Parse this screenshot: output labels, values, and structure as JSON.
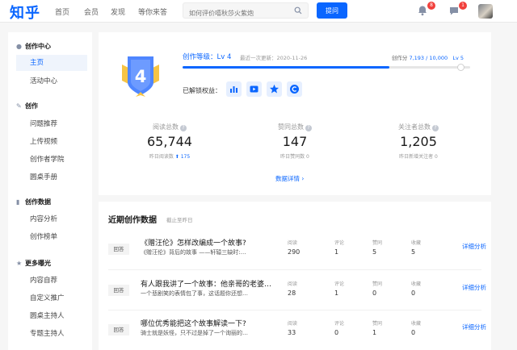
{
  "header": {
    "logo": "知乎",
    "nav": [
      "首页",
      "会员",
      "发现",
      "等你来答"
    ],
    "search_placeholder": "如何评价嘻秋莎火紫炮",
    "ask_label": "提问",
    "notification_count": "8",
    "message_count": "1"
  },
  "sidebar": {
    "sections": [
      {
        "title": "创作中心",
        "icon": "person-icon",
        "items": [
          "主页",
          "活动中心"
        ]
      },
      {
        "title": "创作",
        "icon": "pen-icon",
        "items": [
          "问题推荐",
          "上传视频",
          "创作者学院",
          "圆桌手册"
        ]
      },
      {
        "title": "创作数据",
        "icon": "chart-icon",
        "items": [
          "内容分析",
          "创作榜单"
        ]
      },
      {
        "title": "更多曝光",
        "icon": "star-icon",
        "items": [
          "内容自荐",
          "自定义推广",
          "圆桌主持人",
          "专题主持人"
        ]
      }
    ],
    "active_item": "主页"
  },
  "level": {
    "badge_number": "4",
    "title": "创作等级：Lv 4",
    "updated": "最近一次更新：2020-11-26",
    "score_label": "创作分",
    "score_value": "7,193 / 10,000",
    "next_level": "Lv 5",
    "progress_fraction": 0.7193,
    "rights_label": "已解锁权益：",
    "rights_icons": [
      "bar-chart-icon",
      "video-icon",
      "star-icon",
      "c-coin-icon"
    ]
  },
  "stats": [
    {
      "label": "阅读总数",
      "value": "65,744",
      "sub_prefix": "昨日阅读数",
      "sub_value": "175"
    },
    {
      "label": "赞同总数",
      "value": "147",
      "sub_prefix": "昨日赞同数",
      "sub_value": "0"
    },
    {
      "label": "关注者总数",
      "value": "1,205",
      "sub_prefix": "昨日新增关注者",
      "sub_value": "0"
    }
  ],
  "detail_link": "数据详情 ›",
  "recent": {
    "title": "近期创作数据",
    "subtitle": "截止至昨日",
    "metric_labels": [
      "阅读",
      "评论",
      "赞同",
      "收藏"
    ],
    "link_label": "详细分析",
    "rows": [
      {
        "tag": "回答",
        "title": "《赠汪伦》怎样改编成一个故事?",
        "excerpt": "《赠汪伦》背后的故事 ——轩辕三缺时:…",
        "metrics": [
          "290",
          "1",
          "5",
          "5"
        ]
      },
      {
        "tag": "回答",
        "title": "有人跟我讲了一个故事：他亲哥的老婆…",
        "excerpt": "一个悲剧笑的表情包了事，这话题你还想…",
        "metrics": [
          "28",
          "1",
          "0",
          "0"
        ]
      },
      {
        "tag": "回答",
        "title": "哪位优秀能把这个故事解读一下?",
        "excerpt": "骑士就是妖怪，只不过是掉了一个询丽的…",
        "metrics": [
          "33",
          "0",
          "1",
          "0"
        ]
      }
    ]
  },
  "colors": {
    "brand": "#0a66ff",
    "badge_red": "#f1403c"
  }
}
